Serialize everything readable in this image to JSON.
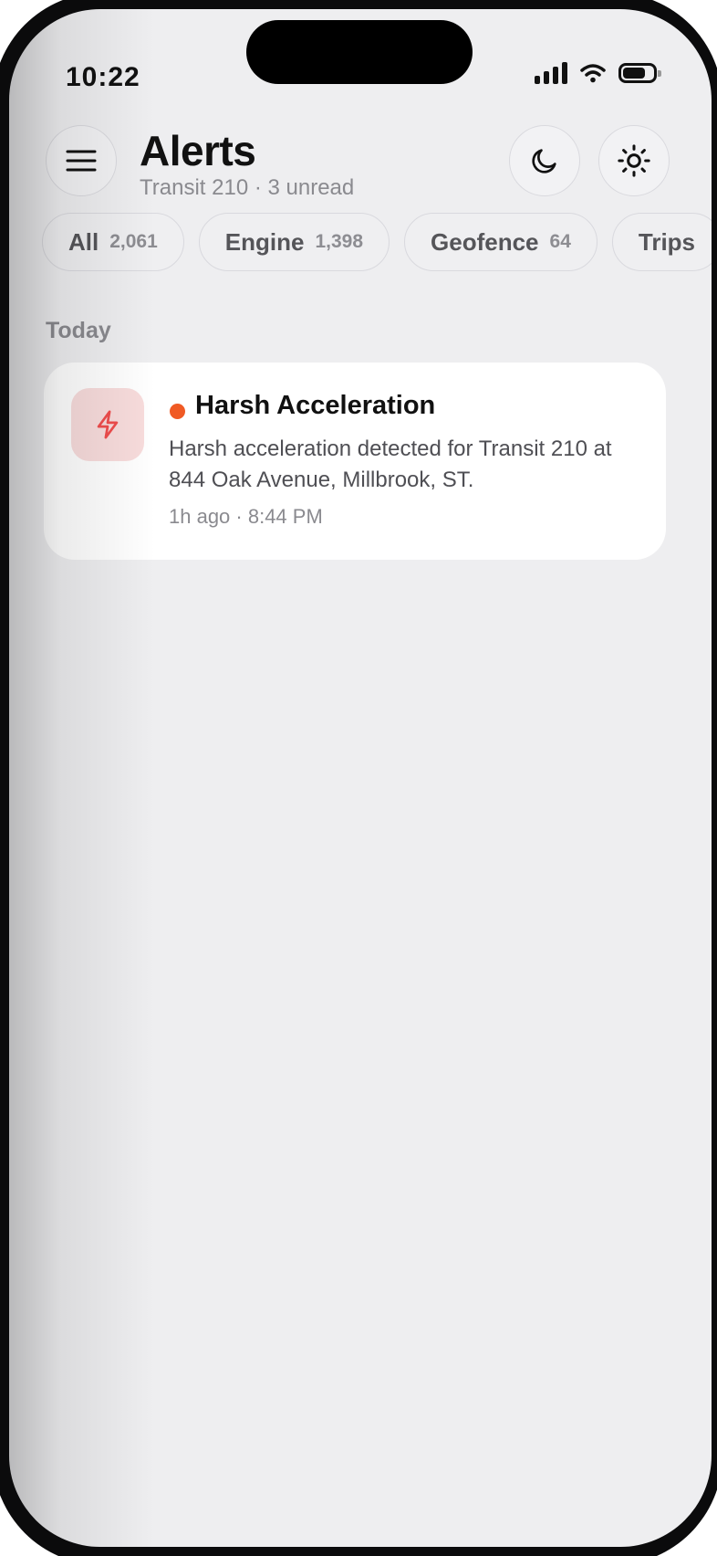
{
  "status_bar": {
    "time": "10:22"
  },
  "header": {
    "title": "Alerts",
    "subtitle": "Transit 210 · 3 unread"
  },
  "filters": [
    {
      "label": "All",
      "count": "2,061"
    },
    {
      "label": "Engine",
      "count": "1,398"
    },
    {
      "label": "Geofence",
      "count": "64"
    },
    {
      "label": "Trips",
      "count": ""
    }
  ],
  "sections": [
    {
      "label": "Today",
      "alerts": [
        {
          "title": "Harsh Acceleration",
          "body": "Harsh acceleration detected for Transit 210 at 844 Oak Avenue, Millbrook, ST.",
          "meta": "1h ago · 8:44 PM",
          "icon": "lightning-icon",
          "unread": true
        }
      ]
    }
  ],
  "colors": {
    "unread_dot": "#f05a24",
    "alert_icon": "#ef4d4d",
    "alert_icon_bg": "#f8dcdc"
  }
}
